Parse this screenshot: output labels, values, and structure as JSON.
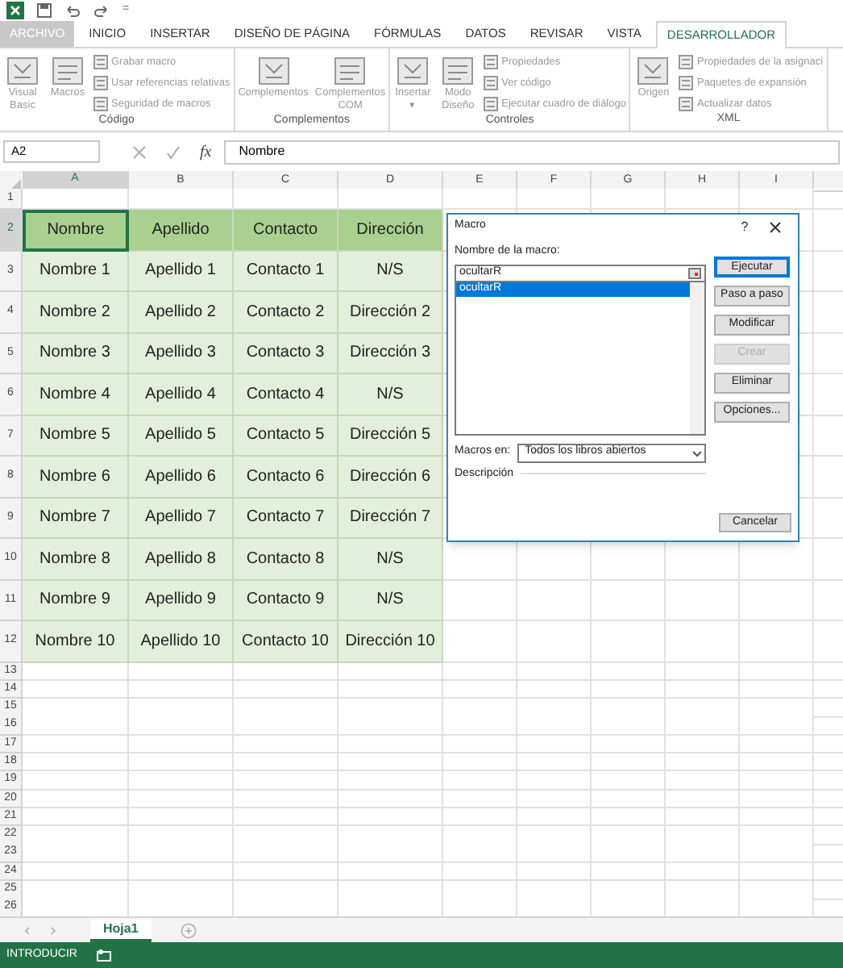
{
  "quick_access": {
    "customize": "="
  },
  "ribbon_tabs": [
    {
      "label": "ARCHIVO",
      "kind": "file",
      "selected": false
    },
    {
      "label": "INICIO",
      "kind": "tab",
      "selected": false
    },
    {
      "label": "INSERTAR",
      "kind": "tab",
      "selected": false
    },
    {
      "label": "DISEÑO DE PÁGINA",
      "kind": "tab",
      "selected": false
    },
    {
      "label": "FÓRMULAS",
      "kind": "tab",
      "selected": false
    },
    {
      "label": "DATOS",
      "kind": "tab",
      "selected": false
    },
    {
      "label": "REVISAR",
      "kind": "tab",
      "selected": false
    },
    {
      "label": "VISTA",
      "kind": "tab",
      "selected": false
    },
    {
      "label": "DESARROLLADOR",
      "kind": "tab",
      "selected": true
    }
  ],
  "ribbon_groups": [
    {
      "label": "Código",
      "large": [
        {
          "label": "Visual Basic",
          "disabled": true
        },
        {
          "label": "Macros",
          "disabled": true
        }
      ],
      "small": [
        {
          "label": "Grabar macro",
          "disabled": true
        },
        {
          "label": "Usar referencias relativas",
          "disabled": true
        },
        {
          "label": "Seguridad de macros",
          "disabled": true
        }
      ]
    },
    {
      "label": "Complementos",
      "large": [
        {
          "label": "Complementos",
          "disabled": true
        },
        {
          "label": "Complementos COM",
          "disabled": true
        }
      ]
    },
    {
      "label": "Controles",
      "large": [
        {
          "label": "Insertar",
          "disabled": true,
          "caret": "▾"
        },
        {
          "label": "Modo Diseño",
          "disabled": true
        }
      ],
      "small": [
        {
          "label": "Propiedades",
          "disabled": true
        },
        {
          "label": "Ver código",
          "disabled": true
        },
        {
          "label": "Ejecutar cuadro de diálogo",
          "disabled": true
        }
      ]
    },
    {
      "label": "XML",
      "large": [
        {
          "label": "Origen",
          "disabled": true
        }
      ],
      "small": [
        {
          "label": "Propiedades de la asignaci",
          "disabled": true
        },
        {
          "label": "Paquetes de expansión",
          "disabled": true
        },
        {
          "label": "Actualizar datos",
          "disabled": true
        }
      ]
    }
  ],
  "formula_bar": {
    "name_box": "A2",
    "function_label": "fx",
    "value": "Nombre"
  },
  "columns": [
    {
      "label": "A",
      "selected": true
    },
    {
      "label": "B",
      "selected": false
    },
    {
      "label": "C",
      "selected": false
    },
    {
      "label": "D",
      "selected": false
    },
    {
      "label": "E",
      "selected": false
    },
    {
      "label": "F",
      "selected": false
    },
    {
      "label": "G",
      "selected": false
    },
    {
      "label": "H",
      "selected": false
    },
    {
      "label": "I",
      "selected": false
    }
  ],
  "rows": [
    {
      "number": "1",
      "kind": "empty",
      "selected": false
    },
    {
      "number": "2",
      "kind": "header",
      "selected": true,
      "cells": [
        "Nombre",
        "Apellido",
        "Contacto",
        "Dirección"
      ]
    },
    {
      "number": "3",
      "kind": "data",
      "selected": false,
      "cells": [
        "Nombre 1",
        "Apellido 1",
        "Contacto 1",
        "N/S"
      ]
    },
    {
      "number": "4",
      "kind": "data",
      "selected": false,
      "cells": [
        "Nombre 2",
        "Apellido 2",
        "Contacto 2",
        "Dirección 2"
      ]
    },
    {
      "number": "5",
      "kind": "data",
      "selected": false,
      "cells": [
        "Nombre 3",
        "Apellido 3",
        "Contacto 3",
        "Dirección 3"
      ]
    },
    {
      "number": "6",
      "kind": "data",
      "selected": false,
      "cells": [
        "Nombre 4",
        "Apellido 4",
        "Contacto 4",
        "N/S"
      ]
    },
    {
      "number": "7",
      "kind": "data",
      "selected": false,
      "cells": [
        "Nombre 5",
        "Apellido 5",
        "Contacto 5",
        "Dirección 5"
      ]
    },
    {
      "number": "8",
      "kind": "data",
      "selected": false,
      "cells": [
        "Nombre 6",
        "Apellido 6",
        "Contacto 6",
        "Dirección 6"
      ]
    },
    {
      "number": "9",
      "kind": "data",
      "selected": false,
      "cells": [
        "Nombre 7",
        "Apellido 7",
        "Contacto 7",
        "Dirección 7"
      ]
    },
    {
      "number": "10",
      "kind": "data",
      "selected": false,
      "cells": [
        "Nombre 8",
        "Apellido 8",
        "Contacto 8",
        "N/S"
      ]
    },
    {
      "number": "11",
      "kind": "data",
      "selected": false,
      "cells": [
        "Nombre 9",
        "Apellido 9",
        "Contacto 9",
        "N/S"
      ]
    },
    {
      "number": "12",
      "kind": "data",
      "selected": false,
      "cells": [
        "Nombre 10",
        "Apellido 10",
        "Contacto 10",
        "Dirección 10"
      ]
    },
    {
      "number": "13",
      "kind": "empty",
      "selected": false
    },
    {
      "number": "14",
      "kind": "empty",
      "selected": false
    },
    {
      "number": "15",
      "kind": "empty",
      "selected": false
    },
    {
      "number": "16",
      "kind": "empty",
      "selected": false
    },
    {
      "number": "17",
      "kind": "empty",
      "selected": false
    },
    {
      "number": "18",
      "kind": "empty",
      "selected": false
    },
    {
      "number": "19",
      "kind": "empty",
      "selected": false
    },
    {
      "number": "20",
      "kind": "empty",
      "selected": false
    },
    {
      "number": "21",
      "kind": "empty",
      "selected": false
    },
    {
      "number": "22",
      "kind": "empty",
      "selected": false
    },
    {
      "number": "23",
      "kind": "empty",
      "selected": false
    },
    {
      "number": "24",
      "kind": "empty",
      "selected": false
    },
    {
      "number": "25",
      "kind": "empty",
      "selected": false
    },
    {
      "number": "26",
      "kind": "empty",
      "selected": false
    }
  ],
  "dialog": {
    "title": "Macro",
    "help": "?",
    "name_label": "Nombre de la macro:",
    "name_value": "ocultarR",
    "macros": [
      {
        "label": "ocultarR",
        "selected": true
      }
    ],
    "buttons": [
      {
        "label": "Ejecutar",
        "disabled": false,
        "default": true
      },
      {
        "label": "Paso a paso",
        "disabled": false,
        "default": false
      },
      {
        "label": "Modificar",
        "disabled": false,
        "default": false
      },
      {
        "label": "Crear",
        "disabled": true,
        "default": false
      },
      {
        "label": "Eliminar",
        "disabled": false,
        "default": false
      },
      {
        "label": "Opciones...",
        "disabled": false,
        "default": false
      }
    ],
    "macros_in_label": "Macros en:",
    "macros_in_value": "Todos los libros abiertos",
    "description_label": "Descripción",
    "cancel": "Cancelar"
  },
  "sheet_tabs": [
    {
      "label": "Hoja1",
      "selected": true
    }
  ],
  "status_bar": {
    "mode": "INTRODUCIR"
  }
}
